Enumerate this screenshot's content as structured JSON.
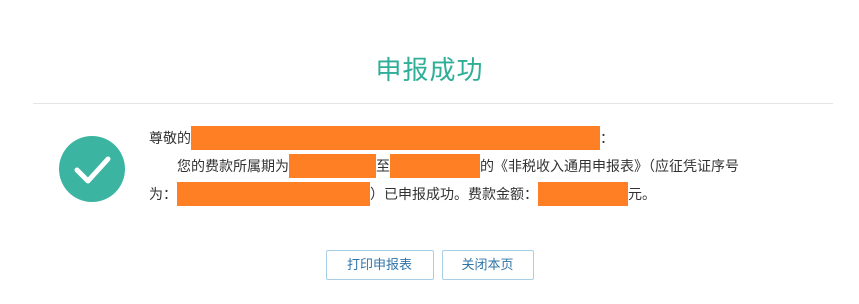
{
  "title": "申报成功",
  "colors": {
    "accent": "#2fae98",
    "check_bg": "#3bb5a2",
    "redaction": "#ff7f24",
    "button_text": "#2f74a8",
    "button_border": "#a9cfe6"
  },
  "icons": {
    "success": "check-circle-icon"
  },
  "message": {
    "greeting_prefix": "尊敬的",
    "greeting_suffix": "：",
    "period_prefix": "您的费款所属期为",
    "period_to": "至",
    "form_text": "的《非税收入通用申报表》（应征凭证序号",
    "serial_prefix": "为：",
    "serial_suffix": "）已申报成功。费款金额：",
    "amount_suffix": "元。"
  },
  "buttons": {
    "print": "打印申报表",
    "close": "关闭本页"
  }
}
